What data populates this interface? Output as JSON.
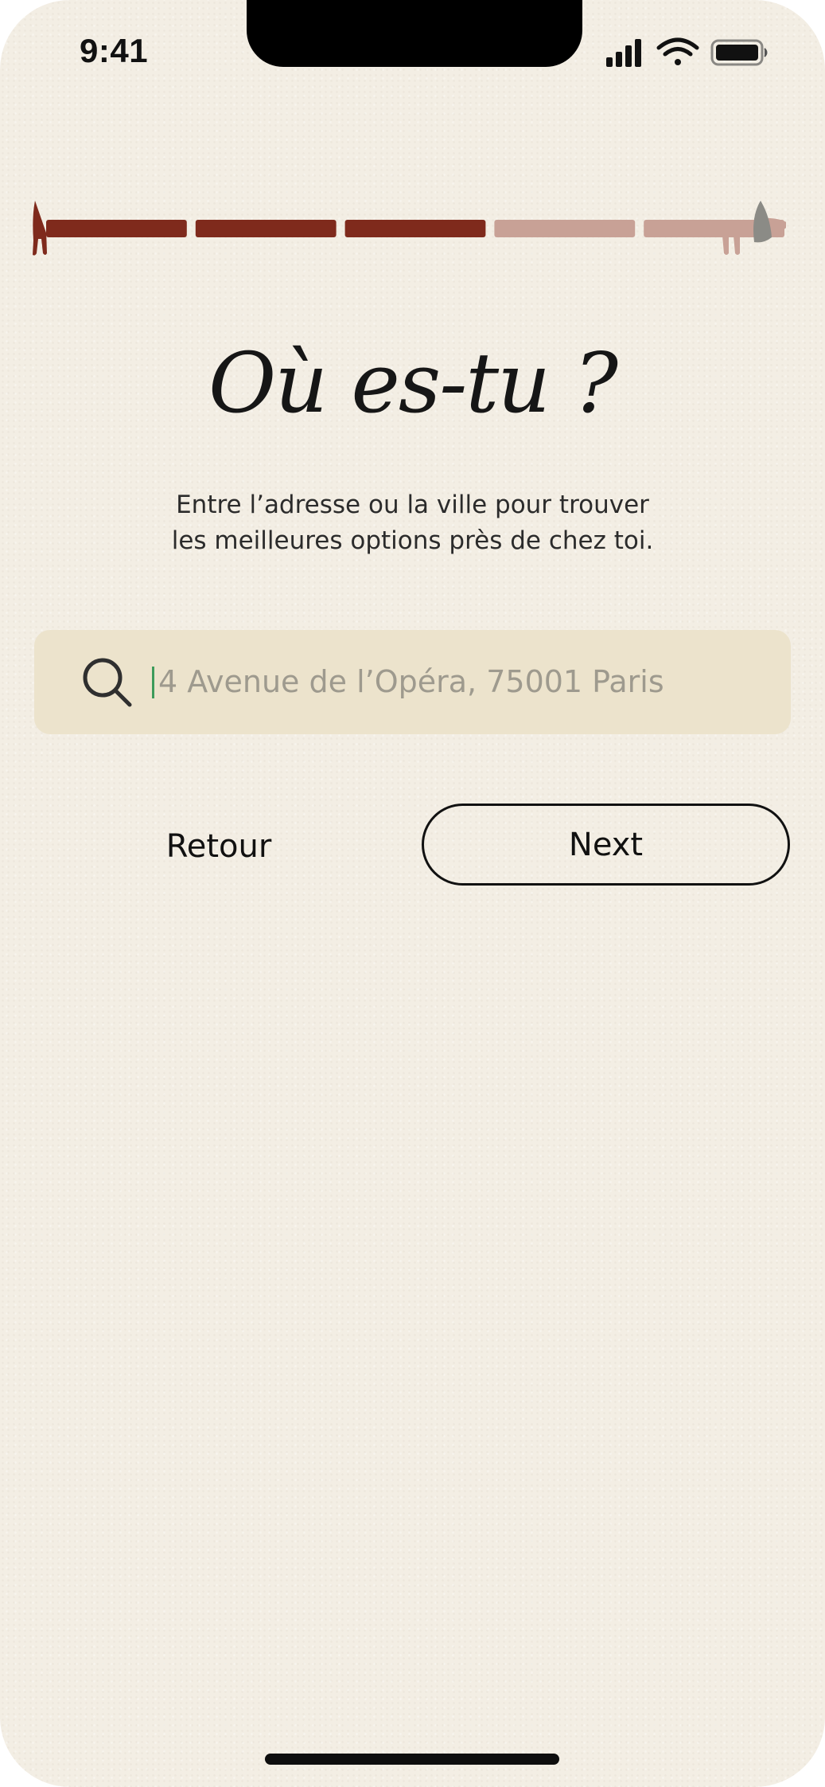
{
  "status_bar": {
    "time": "9:41",
    "icons": [
      "cellular-signal-icon",
      "wifi-icon",
      "battery-icon"
    ]
  },
  "progress": {
    "total_steps": 5,
    "completed_steps": 3,
    "colors": {
      "completed": "#7f2a1c",
      "remaining": "#c8a196",
      "head": "#8b8b86"
    },
    "icons": [
      "dachshund-tail-icon",
      "dachshund-head-icon"
    ]
  },
  "title": "Où es-tu ?",
  "subtitle": {
    "line1": "Entre l’adresse ou la ville pour trouver",
    "line2": "les meilleures options près de chez toi."
  },
  "search": {
    "placeholder": "4 Avenue de l’Opéra, 75001 Paris",
    "value": "",
    "icon": "search-icon"
  },
  "actions": {
    "back_label": "Retour",
    "next_label": "Next"
  },
  "colors": {
    "background": "#f3eee4",
    "search_field": "#ece3cc",
    "caret": "#3d9b5a",
    "text": "#161616"
  }
}
